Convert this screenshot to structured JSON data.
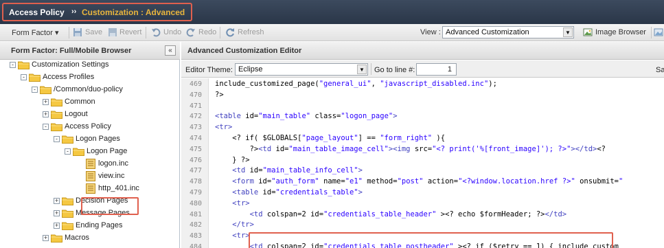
{
  "title": {
    "breadcrumb_root": "Access Policy",
    "separator": "››",
    "breadcrumb_current": "Customization : Advanced"
  },
  "toolbar": {
    "form_factor": "Form Factor ▾",
    "save": "Save",
    "revert": "Revert",
    "undo": "Undo",
    "redo": "Redo",
    "refresh": "Refresh",
    "view_label": "View :",
    "view_value": "Advanced Customization",
    "image_browser": "Image Browser"
  },
  "left_panel": {
    "title": "Form Factor: Full/Mobile Browser",
    "collapse": "«",
    "tree": [
      {
        "label": "Customization Settings",
        "type": "folder",
        "state": "-"
      },
      {
        "label": "Access Profiles",
        "type": "folder",
        "state": "-"
      },
      {
        "label": "/Common/duo-policy",
        "type": "folder",
        "state": "-"
      },
      {
        "label": "Common",
        "type": "folder",
        "state": "+"
      },
      {
        "label": "Logout",
        "type": "folder",
        "state": "+"
      },
      {
        "label": "Access Policy",
        "type": "folder",
        "state": "-"
      },
      {
        "label": "Logon Pages",
        "type": "folder",
        "state": "-"
      },
      {
        "label": "Logon Page",
        "type": "folder",
        "state": "-"
      },
      {
        "label": "logon.inc",
        "type": "file",
        "selected": true
      },
      {
        "label": "view.inc",
        "type": "file"
      },
      {
        "label": "http_401.inc",
        "type": "file"
      },
      {
        "label": "Decision Pages",
        "type": "folder",
        "state": "+"
      },
      {
        "label": "Message Pages",
        "type": "folder",
        "state": "+"
      },
      {
        "label": "Ending Pages",
        "type": "folder",
        "state": "+"
      },
      {
        "label": "Macros",
        "type": "folder",
        "state": "+"
      }
    ]
  },
  "editor": {
    "title": "Advanced Customization Editor",
    "theme_label": "Editor Theme:",
    "theme_value": "Eclipse",
    "goto_label": "Go to line #:",
    "goto_value": "1",
    "save_partial": "Sa",
    "lines": [
      {
        "n": "469",
        "html": "include_customized_page(<span class=\"s\">\"general_ui\"</span>, <span class=\"s\">\"javascript_disabled.inc\"</span>);"
      },
      {
        "n": "470",
        "html": "?>"
      },
      {
        "n": "471",
        "html": ""
      },
      {
        "n": "472",
        "html": "<span class=\"t\">&lt;table</span> id=<span class=\"s\">\"main_table\"</span> class=<span class=\"s\">\"logon_page\"</span><span class=\"t\">&gt;</span>"
      },
      {
        "n": "473",
        "html": "<span class=\"t\">&lt;tr&gt;</span>"
      },
      {
        "n": "474",
        "html": "    &lt;? if( $GLOBALS[<span class=\"s\">\"page_layout\"</span>] == <span class=\"s\">\"form_right\"</span> ){"
      },
      {
        "n": "475",
        "html": "        ?&gt;<span class=\"t\">&lt;td</span> id=<span class=\"s\">\"main_table_image_cell\"</span><span class=\"t\">&gt;&lt;img</span> src=<span class=\"s\">\"&lt;? print('%[front_image]'); ?&gt;\"</span><span class=\"t\">&gt;&lt;/td&gt;</span>&lt;?"
      },
      {
        "n": "476",
        "html": "    } ?&gt;"
      },
      {
        "n": "477",
        "html": "    <span class=\"t\">&lt;td</span> id=<span class=\"s\">\"main_table_info_cell\"</span><span class=\"t\">&gt;</span>"
      },
      {
        "n": "478",
        "html": "    <span class=\"t\">&lt;form</span> id=<span class=\"s\">\"auth_form\"</span> name=<span class=\"s\">\"e1\"</span> method=<span class=\"s\">\"post\"</span> action=<span class=\"s\">\"&lt;?window.location.href ?&gt;\"</span> onsubmit=<span class=\"s\">\"</span>"
      },
      {
        "n": "479",
        "html": "    <span class=\"t\">&lt;table</span> id=<span class=\"s\">\"credentials_table\"</span><span class=\"t\">&gt;</span>"
      },
      {
        "n": "480",
        "html": "    <span class=\"t\">&lt;tr&gt;</span>"
      },
      {
        "n": "481",
        "html": "        <span class=\"t\">&lt;td</span> colspan=2 id=<span class=\"s\">\"credentials_table_header\"</span> &gt;&lt;? echo $formHeader; ?&gt;<span class=\"t\">&lt;/td&gt;</span>"
      },
      {
        "n": "482",
        "html": "    <span class=\"t\">&lt;/tr&gt;</span>"
      },
      {
        "n": "483",
        "html": "    <span class=\"t\">&lt;tr&gt;</span>"
      },
      {
        "n": "484",
        "html": "        <span class=\"t\">&lt;td</span> colspan=2 id=<span class=\"s\">\"credentials_table_postheader\"</span> &gt;&lt;? if ($retry == 1) { include_custom"
      }
    ]
  },
  "colors": {
    "highlight": "#e0604e",
    "crumb_accent": "#e8b53d",
    "folder": "#f5c842"
  }
}
